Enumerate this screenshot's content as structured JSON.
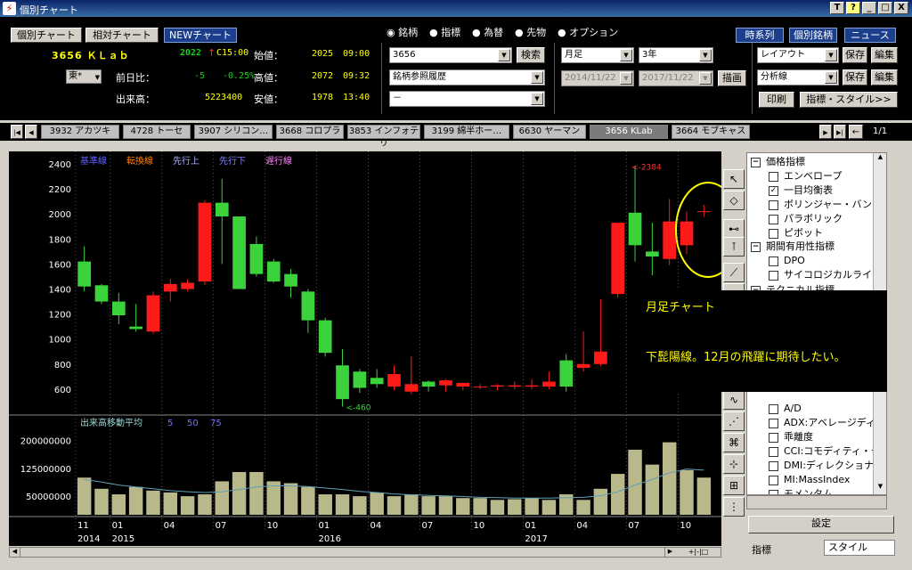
{
  "window": {
    "title": "個別チャート",
    "buttons": [
      "T",
      "?",
      "_",
      "□",
      "X"
    ]
  },
  "nav": {
    "tabs": [
      "個別チャート",
      "相対チャート",
      "NEWチャート"
    ],
    "right": [
      "時系列",
      "個別銘柄",
      "ニュース"
    ]
  },
  "quote": {
    "code_name": "3656 ＫＬａｂ",
    "price": "2022",
    "arrow": "↑",
    "time": "C15:00",
    "market": "東*",
    "open_label": "始値：",
    "open": "2025",
    "open_time": "09:00",
    "change_label": "前日比：",
    "change": "-5",
    "change_pct": "-0.25%",
    "high_label": "高値：",
    "high": "2072",
    "high_time": "09:32",
    "volume_label": "出来高：",
    "volume": "5223400",
    "low_label": "安値：",
    "low": "1978",
    "low_time": "13:40"
  },
  "radios": [
    {
      "label": "銘柄",
      "checked": true
    },
    {
      "label": "指標",
      "checked": false
    },
    {
      "label": "為替",
      "checked": false
    },
    {
      "label": "先物",
      "checked": false
    },
    {
      "label": "オプション",
      "checked": false
    }
  ],
  "search": {
    "code": "3656",
    "button": "検索",
    "history": "銘柄参照履歴",
    "blank": "－"
  },
  "period": {
    "bar": "月足",
    "span": "3年",
    "from": "2014/11/22",
    "to": "2017/11/22",
    "draw": "描画"
  },
  "right_controls": {
    "layout": "レイアウト",
    "analysis": "分析線",
    "save": "保存",
    "edit": "編集",
    "print": "印刷",
    "style": "指標・スタイル>>"
  },
  "stock_tabs": [
    "3932 アカツキ",
    "4728 トーセ",
    "3907 シリコン…",
    "3668 コロプラ",
    "3853 インフォテリ",
    "3199 綿半ホー…",
    "6630 ヤーマン",
    "3656 KLab",
    "3664 モブキャス"
  ],
  "tab_page": "1/1",
  "chart": {
    "legend": [
      "基準線",
      "転換線",
      "先行上",
      "先行下",
      "遅行線"
    ],
    "legend_colors": [
      "#6060ff",
      "#ff8000",
      "#b0b0ff",
      "#8080ff",
      "#ff80ff"
    ],
    "y_ticks": [
      "2400",
      "2200",
      "2000",
      "1800",
      "1600",
      "1400",
      "1200",
      "1000",
      "800",
      "600"
    ],
    "max_note": "<-2384",
    "min_note": "<-460",
    "volume_title": "出来高移動平均",
    "volume_ma": [
      "5",
      "50",
      "75"
    ],
    "volume_ticks": [
      "200000000",
      "125000000",
      "50000000"
    ],
    "x_months": [
      "11",
      "01",
      "04",
      "07",
      "10",
      "01",
      "04",
      "07",
      "10",
      "01",
      "04",
      "07",
      "10"
    ],
    "x_years": [
      "2014",
      "2015",
      "2016",
      "2017"
    ]
  },
  "chart_data": {
    "type": "candlestick",
    "x": [
      "2014-11",
      "2014-12",
      "2015-01",
      "2015-02",
      "2015-03",
      "2015-04",
      "2015-05",
      "2015-06",
      "2015-07",
      "2015-08",
      "2015-09",
      "2015-10",
      "2015-11",
      "2015-12",
      "2016-01",
      "2016-02",
      "2016-03",
      "2016-04",
      "2016-05",
      "2016-06",
      "2016-07",
      "2016-08",
      "2016-09",
      "2016-10",
      "2016-11",
      "2016-12",
      "2017-01",
      "2017-02",
      "2017-03",
      "2017-04",
      "2017-05",
      "2017-06",
      "2017-07",
      "2017-08",
      "2017-09",
      "2017-10",
      "2017-11"
    ],
    "open": [
      1620,
      1430,
      1300,
      1100,
      1060,
      1380,
      1400,
      1460,
      2090,
      1980,
      1760,
      1620,
      1520,
      1380,
      1150,
      790,
      740,
      690,
      620,
      580,
      660,
      630,
      620,
      620,
      620,
      620,
      620,
      620,
      830,
      770,
      800,
      1360,
      2010,
      1700,
      1640,
      1750,
      2022
    ],
    "close": [
      1420,
      1300,
      1190,
      1080,
      1350,
      1440,
      1450,
      2090,
      1980,
      1400,
      1520,
      1460,
      1420,
      1150,
      890,
      520,
      610,
      640,
      720,
      640,
      620,
      670,
      650,
      620,
      630,
      630,
      630,
      660,
      620,
      800,
      900,
      1930,
      1750,
      1660,
      1940,
      1940,
      2022
    ],
    "high": [
      1740,
      1440,
      1370,
      1280,
      1380,
      1480,
      1480,
      2110,
      2280,
      1980,
      1820,
      1640,
      1560,
      1400,
      1170,
      920,
      760,
      760,
      790,
      860,
      670,
      680,
      650,
      640,
      640,
      660,
      680,
      740,
      880,
      1060,
      1320,
      1900,
      2384,
      1930,
      2120,
      2020,
      2072
    ],
    "low": [
      1380,
      1280,
      1120,
      1060,
      1040,
      1300,
      1380,
      1430,
      1600,
      1400,
      1500,
      1450,
      1330,
      1050,
      860,
      460,
      570,
      610,
      590,
      560,
      580,
      580,
      590,
      600,
      590,
      600,
      600,
      600,
      580,
      740,
      780,
      1330,
      1620,
      1510,
      1590,
      1680,
      1978
    ],
    "volume": [
      100,
      70,
      55,
      75,
      65,
      60,
      50,
      55,
      90,
      115,
      115,
      90,
      85,
      75,
      55,
      55,
      50,
      60,
      50,
      55,
      50,
      50,
      45,
      45,
      40,
      42,
      45,
      40,
      55,
      40,
      70,
      110,
      175,
      135,
      195,
      120,
      100
    ],
    "volume_unit": "1e6 shares (approx)",
    "volume_ma": [
      95,
      88,
      80,
      75,
      70,
      65,
      62,
      60,
      62,
      68,
      75,
      78,
      78,
      76,
      72,
      68,
      63,
      60,
      56,
      54,
      52,
      51,
      49,
      47,
      46,
      45,
      45,
      45,
      46,
      47,
      51,
      62,
      80,
      95,
      113,
      123,
      120
    ],
    "ylim": [
      400,
      2500
    ]
  },
  "toolbar_icons": [
    "cursor-icon",
    "eraser-icon",
    "hline-icon",
    "vline-icon",
    "trendline-icon",
    "fib-icon",
    "wave-icon",
    "fan-icon",
    "spiral-icon",
    "fit-icon",
    "signal-icon",
    "grid-icon"
  ],
  "indicator_panel": {
    "groups": [
      {
        "title": "価格指標",
        "items": [
          {
            "label": "エンベロープ",
            "checked": false
          },
          {
            "label": "一目均衡表",
            "checked": true
          },
          {
            "label": "ボリンジャー・バンド",
            "checked": false
          },
          {
            "label": "パラボリック",
            "checked": false
          },
          {
            "label": "ピボット",
            "checked": false
          }
        ]
      },
      {
        "title": "期間有用性指標",
        "items": [
          {
            "label": "DPO",
            "checked": false
          },
          {
            "label": "サイコロジカルライン",
            "checked": false
          }
        ]
      },
      {
        "title": "テクニカル指標",
        "items": [
          {
            "label": "A/D",
            "checked": false
          },
          {
            "label": "ADX:アベレージディレ",
            "checked": false
          },
          {
            "label": "乖離度",
            "checked": false
          },
          {
            "label": "CCI:コモディティ・チャ",
            "checked": false
          },
          {
            "label": "DMI:ディレクショナル",
            "checked": false
          },
          {
            "label": "MI:MassIndex",
            "checked": false
          },
          {
            "label": "モメンタム",
            "checked": false
          }
        ]
      }
    ],
    "settings_button": "設定",
    "bottom_tabs": [
      "指標",
      "スタイル"
    ]
  },
  "annotation": {
    "title": "月足チャート",
    "body": "下髭陽線。12月の飛躍に期待したい。"
  }
}
